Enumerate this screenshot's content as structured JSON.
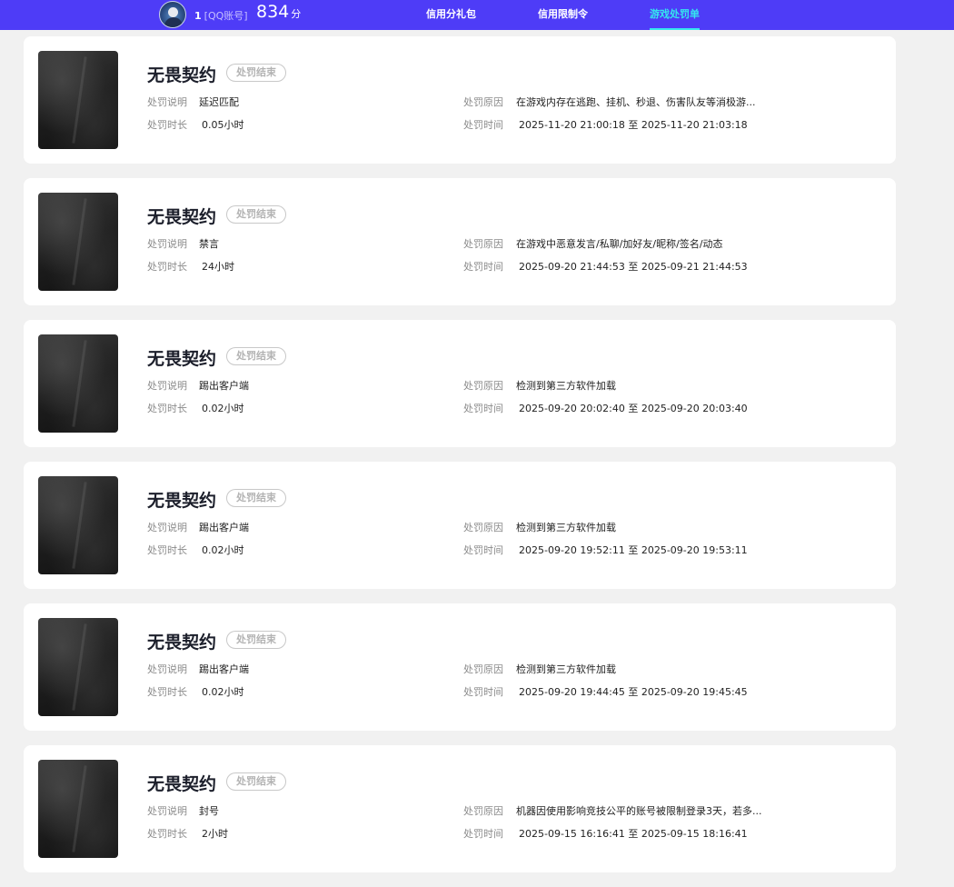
{
  "header": {
    "user_number": "1",
    "account_type": "[QQ账号]",
    "score": "834",
    "score_unit": "分",
    "nav": [
      {
        "label": "信用分礼包",
        "active": false
      },
      {
        "label": "信用限制令",
        "active": false
      },
      {
        "label": "游戏处罚单",
        "active": true
      }
    ]
  },
  "labels": {
    "description": "处罚说明",
    "duration": "处罚时长",
    "reason": "处罚原因",
    "time": "处罚时间"
  },
  "records": [
    {
      "game": "无畏契约",
      "status": "处罚结束",
      "description": "延迟匹配",
      "duration": "0.05小时",
      "reason": "在游戏内存在逃跑、挂机、秒退、伤害队友等消极游...",
      "time": "2025-11-20 21:00:18 至 2025-11-20 21:03:18"
    },
    {
      "game": "无畏契约",
      "status": "处罚结束",
      "description": "禁言",
      "duration": "24小时",
      "reason": "在游戏中恶意发言/私聊/加好友/昵称/签名/动态",
      "time": "2025-09-20 21:44:53 至 2025-09-21 21:44:53"
    },
    {
      "game": "无畏契约",
      "status": "处罚结束",
      "description": "踢出客户端",
      "duration": "0.02小时",
      "reason": "检测到第三方软件加载",
      "time": "2025-09-20 20:02:40 至 2025-09-20 20:03:40"
    },
    {
      "game": "无畏契约",
      "status": "处罚结束",
      "description": "踢出客户端",
      "duration": "0.02小时",
      "reason": "检测到第三方软件加载",
      "time": "2025-09-20 19:52:11 至 2025-09-20 19:53:11"
    },
    {
      "game": "无畏契约",
      "status": "处罚结束",
      "description": "踢出客户端",
      "duration": "0.02小时",
      "reason": "检测到第三方软件加载",
      "time": "2025-09-20 19:44:45 至 2025-09-20 19:45:45"
    },
    {
      "game": "无畏契约",
      "status": "处罚结束",
      "description": "封号",
      "duration": "2小时",
      "reason": "机器因使用影响竞技公平的账号被限制登录3天，若多...",
      "time": "2025-09-15 16:16:41 至 2025-09-15 18:16:41"
    }
  ],
  "colors": {
    "header_bg": "#4e3cf7",
    "active_nav": "#35e6ef",
    "page_bg": "#f1f1f1",
    "card_bg": "#ffffff"
  }
}
